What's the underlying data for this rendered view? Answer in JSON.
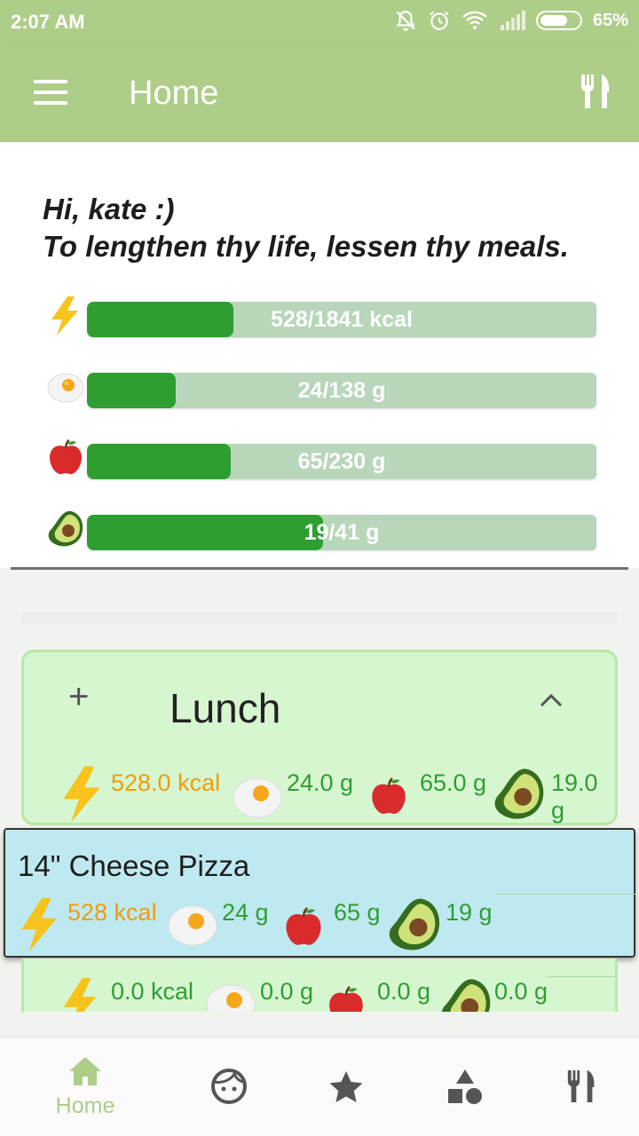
{
  "status_bar": {
    "time": "2:07 AM",
    "battery": "65%",
    "icons": [
      "bell-off-icon",
      "alarm-icon",
      "wifi-icon",
      "signal-icon",
      "battery-icon"
    ]
  },
  "app_bar": {
    "title": "Home",
    "menu_icon": "hamburger-icon",
    "action_icon": "fork-knife-icon"
  },
  "summary": {
    "greeting": "Hi, kate :)",
    "quote": "To lengthen thy life, lessen thy meals.",
    "rows": [
      {
        "icon": "lightning-icon",
        "label": "528/1841 kcal",
        "progress": 0.287
      },
      {
        "icon": "egg-icon",
        "label": "24/138 g",
        "progress": 0.174
      },
      {
        "icon": "apple-icon",
        "label": "65/230 g",
        "progress": 0.283
      },
      {
        "icon": "avocado-icon",
        "label": "19/41 g",
        "progress": 0.463
      }
    ]
  },
  "meal": {
    "title": "Lunch",
    "add_icon": "plus-icon",
    "toggle_icon": "chevron-up-icon",
    "kcal": "528.0 kcal",
    "protein": "24.0 g",
    "carbs": "65.0 g",
    "fat_line1": "19.0",
    "fat_line2": "g"
  },
  "food_item": {
    "name": "14\" Cheese Pizza",
    "kcal": "528 kcal",
    "protein": "24 g",
    "carbs": "65 g",
    "fat": "19 g"
  },
  "meal2": {
    "kcal": "0.0 kcal",
    "protein": "0.0 g",
    "carbs": "0.0 g",
    "fat": "0.0 g"
  },
  "bottom_nav": {
    "items": [
      {
        "icon": "home-icon",
        "label": "Home",
        "active": true
      },
      {
        "icon": "face-icon",
        "label": "",
        "active": false
      },
      {
        "icon": "star-icon",
        "label": "",
        "active": false
      },
      {
        "icon": "shapes-icon",
        "label": "",
        "active": false
      },
      {
        "icon": "fork-knife-icon",
        "label": "",
        "active": false
      }
    ]
  },
  "colors": {
    "primary": "#aecd88",
    "bar_fill": "#2e9e31",
    "bar_track": "#b8d6b9",
    "kcal": "#ef9c0f",
    "macro": "#2e9e31",
    "meal_bg": "#d6f6d0",
    "food_bg": "#bfe9f0"
  }
}
